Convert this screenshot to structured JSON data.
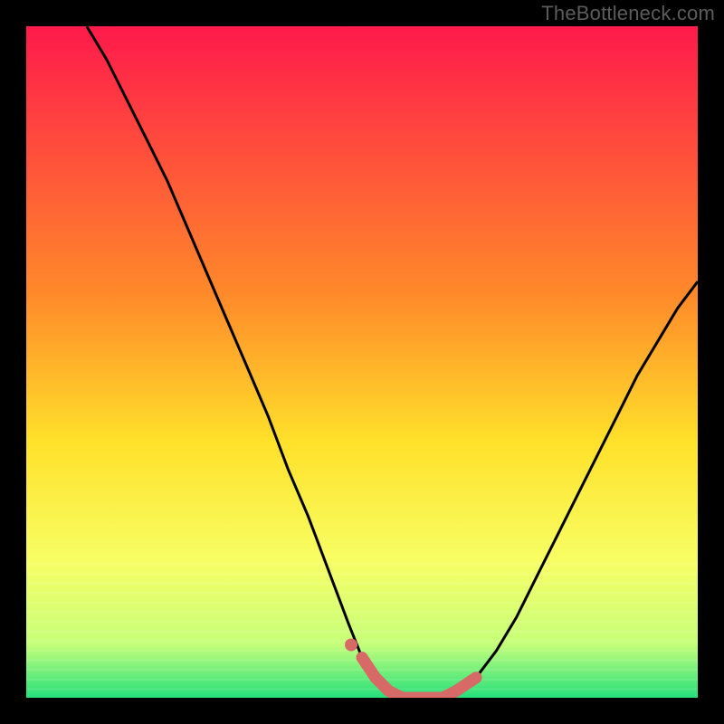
{
  "watermark": "TheBottleneck.com",
  "colors": {
    "black": "#000000",
    "curve": "#000000",
    "marker": "#d76a66",
    "gradient_top": "#ff1a4b",
    "gradient_mid1": "#ff8a2a",
    "gradient_mid2": "#ffe12a",
    "gradient_mid3": "#f7ff66",
    "gradient_mid4": "#c6ff7a",
    "gradient_bottom": "#25e07a"
  },
  "chart_data": {
    "type": "line",
    "title": "",
    "xlabel": "",
    "ylabel": "",
    "xlim": [
      0,
      100
    ],
    "ylim": [
      0,
      100
    ],
    "x": [
      9,
      12,
      15,
      18,
      21,
      24,
      27,
      30,
      33,
      36,
      39,
      42,
      45,
      48,
      50,
      52,
      54,
      56,
      58,
      60,
      62,
      64,
      67,
      70,
      73,
      76,
      79,
      82,
      85,
      88,
      91,
      94,
      97,
      100
    ],
    "values": [
      100,
      95,
      89,
      83,
      77,
      70,
      63,
      56,
      49,
      42,
      34,
      27,
      19,
      11,
      6,
      3,
      1,
      0,
      0,
      0,
      0,
      1,
      3,
      7,
      12,
      18,
      24,
      30,
      36,
      42,
      48,
      53,
      58,
      62
    ],
    "flat_region": {
      "x_start": 54,
      "x_end": 64,
      "y": 1
    }
  }
}
